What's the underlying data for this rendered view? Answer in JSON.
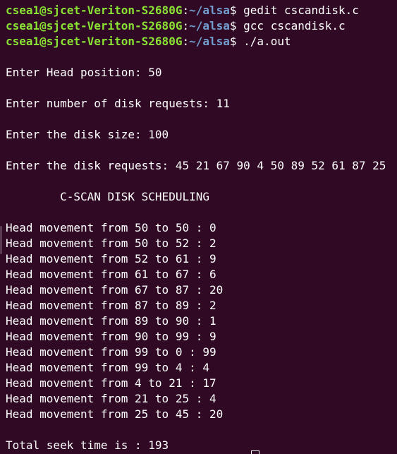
{
  "prompt": {
    "user_host": "csea1@sjcet-Veriton-S2680G",
    "separator": ":",
    "path": "~/alsa",
    "symbol": "$ "
  },
  "commands": [
    "gedit cscandisk.c",
    "gcc cscandisk.c",
    "./a.out"
  ],
  "output": {
    "head_prompt": "Enter Head position: 50",
    "count_prompt": "Enter number of disk requests: 11",
    "size_prompt": "Enter the disk size: 100",
    "requests_prompt": "Enter the disk requests: 45 21 67 90 4 50 89 52 61 87 25",
    "title": "        C-SCAN DISK SCHEDULING",
    "movements": [
      "Head movement from 50 to 50 : 0",
      "Head movement from 50 to 52 : 2",
      "Head movement from 52 to 61 : 9",
      "Head movement from 61 to 67 : 6",
      "Head movement from 67 to 87 : 20",
      "Head movement from 87 to 89 : 2",
      "Head movement from 89 to 90 : 1",
      "Head movement from 90 to 99 : 9",
      "Head movement from 99 to 0 : 99",
      "Head movement from 99 to 4 : 4",
      "Head movement from 4 to 21 : 17",
      "Head movement from 21 to 25 : 4",
      "Head movement from 25 to 45 : 20"
    ],
    "total": "Total seek time is : 193"
  },
  "colors": {
    "background": "#300a24",
    "user_host": "#8ae234",
    "path": "#729fcf",
    "text": "#ffffff"
  }
}
